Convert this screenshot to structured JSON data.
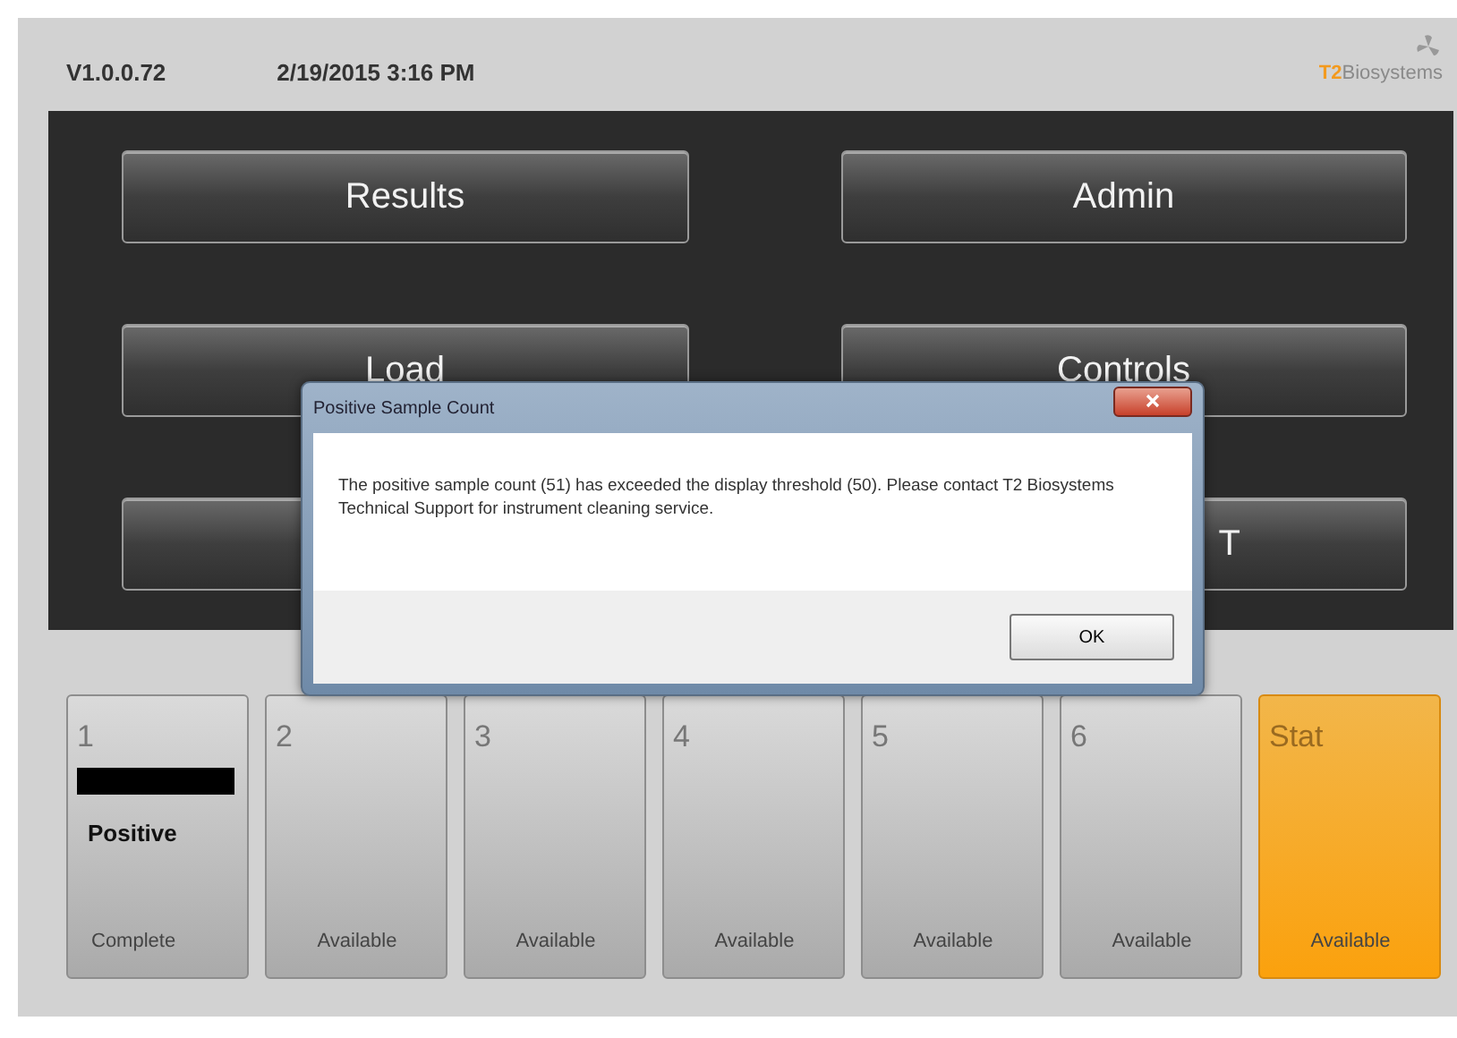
{
  "header": {
    "version": "V1.0.0.72",
    "datetime": "2/19/2015 3:16 PM",
    "logo": {
      "mark": "T2",
      "name": "Biosystems"
    }
  },
  "menu_buttons": [
    {
      "label": "Results",
      "kind": "labeled"
    },
    {
      "label": "Admin",
      "kind": "labeled"
    },
    {
      "label": "Load",
      "kind": "labeled"
    },
    {
      "label": "Controls",
      "kind": "labeled"
    },
    {
      "kind": "blank"
    },
    {
      "label": "T",
      "kind": "partial"
    }
  ],
  "dialog": {
    "title": "Positive Sample Count",
    "message": "The positive sample count (51) has exceeded the display threshold (50).  Please contact T2 Biosystems Technical Support for instrument cleaning service.",
    "ok": "OK"
  },
  "slots": [
    {
      "number": "1",
      "result": "Positive",
      "status": "Complete",
      "kind": "result"
    },
    {
      "number": "2",
      "status": "Available",
      "kind": "empty"
    },
    {
      "number": "3",
      "status": "Available",
      "kind": "empty"
    },
    {
      "number": "4",
      "status": "Available",
      "kind": "empty"
    },
    {
      "number": "5",
      "status": "Available",
      "kind": "empty"
    },
    {
      "number": "6",
      "status": "Available",
      "kind": "empty"
    },
    {
      "number": "Stat",
      "status": "Available",
      "kind": "stat"
    }
  ]
}
